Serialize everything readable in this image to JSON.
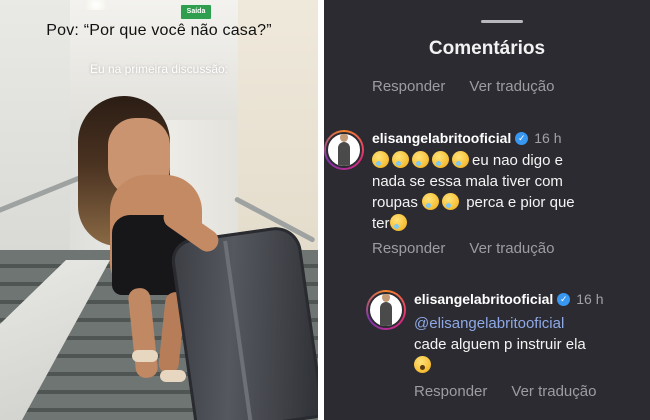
{
  "video": {
    "caption_top": "Pov: “Por que você não casa?”",
    "caption_sub": "Eu na primeira discussão:",
    "exit_sign": "Saída"
  },
  "comments_panel": {
    "title": "Comentários",
    "top_actions": {
      "reply": "Responder",
      "translate": "Ver tradução"
    },
    "comments": [
      {
        "username": "elisangelabritooficial",
        "time": "16 h",
        "emoji_prefix": [
          "crying-face-emoji",
          "crying-face-emoji",
          "crying-face-emoji",
          "crying-face-emoji",
          "crying-face-emoji"
        ],
        "text_line1": "eu nao digo e",
        "text_line2": "nada se essa mala tiver com",
        "text_line3": "roupas",
        "text_line3_rest": "perca e pior que",
        "text_line4": "ter",
        "reply": "Responder",
        "translate": "Ver tradução"
      },
      {
        "username": "elisangelabritooficial",
        "time": "16 h",
        "mention": "@elisangelabritooficial",
        "text": "cade alguem p instruir ela",
        "emoji": "surprised-face-emoji",
        "reply": "Responder",
        "translate": "Ver tradução"
      }
    ]
  },
  "colors": {
    "panel_background": "#2b2b31",
    "verified_badge": "#3897f0",
    "mention": "#8fa9e6",
    "secondary_text": "#9c9ca3"
  }
}
